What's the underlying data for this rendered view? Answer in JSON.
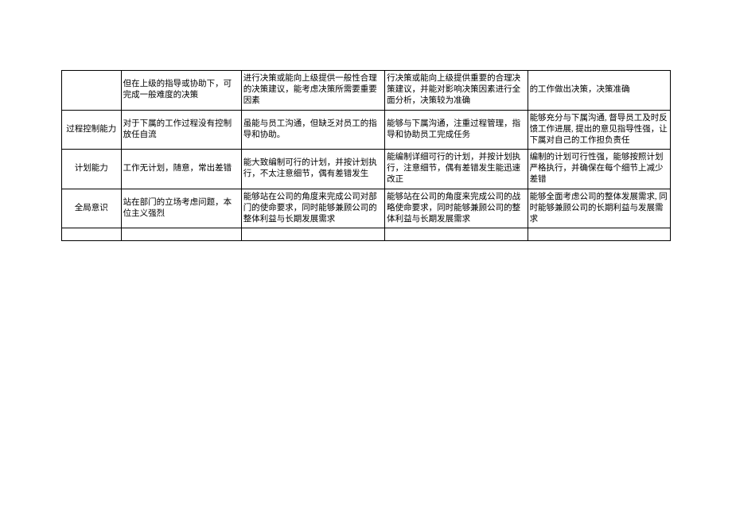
{
  "rows": [
    {
      "label": "",
      "a": "但在上级的指导或协助下，可完成一般难度的决策",
      "b": "进行决策或能向上级提供一般性合理的决策建议，能考虑决策所需要重要因素",
      "c": "行决策或能向上级提供重要的合理决策建议，并能对影响决策因素进行全面分析，决策较为准确",
      "d": "的工作做出决策，决策准确"
    },
    {
      "label": "过程控制能力",
      "a": "对于下属的工作过程没有控制放任自流",
      "b": "虽能与员工沟通，但缺乏对员工的指导和协助。",
      "c": "能够与下属沟通，注重过程管理，指导和协助员工完成任务",
      "d": "能够充分与下属沟通, 督导员工及时反馈工作进展, 提出的意见指导性强，让下属对自己的工作担负责任"
    },
    {
      "label": "计划能力",
      "a": "工作无计划，随意，常出差错",
      "b": "能大致编制可行的计划，并按计划执行，不太注意细节，偶有差错发生",
      "c": "能编制详细可行的计划，并按计划执行，注意细节，偶有差错发生能迅速改正",
      "d": "编制的计划可行性强，能够按照计划严格执行，并确保在每个细节上减少差错"
    },
    {
      "label": "全局意识",
      "a": "站在部门的立场考虑问题，本位主义强烈",
      "b": "能够站在公司的角度来完成公司对部门的使命要求，同时能够兼顾公司的整体利益与长期发展需求",
      "c": "能够站在公司的角度来完成公司的战略使命要求，同时能够兼顾公司的整体利益与长期发展需求",
      "d": "能够全面考虑公司的整体发展需求, 同时能够兼顾公司的长期利益与发展需求"
    }
  ]
}
